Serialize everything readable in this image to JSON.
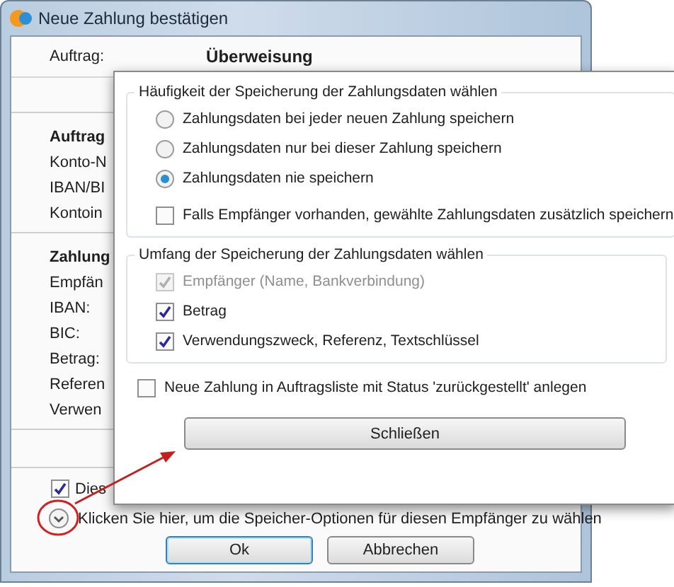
{
  "window": {
    "title": "Neue Zahlung bestätigen"
  },
  "order": {
    "label": "Auftrag:",
    "value": "Überweisung"
  },
  "sections": [
    {
      "title": "Auftrag",
      "fields": [
        "Konto-N",
        "IBAN/BI",
        "Kontoin"
      ]
    },
    {
      "title": "Zahlung",
      "fields": [
        "Empfän",
        "IBAN:",
        "BIC:",
        "Betrag:",
        "Referen",
        "Verwen"
      ]
    }
  ],
  "save_checkbox": {
    "label": "Dies",
    "checked": true
  },
  "options_link": "Klicken Sie hier, um die Speicher-Optionen für diesen Empfänger zu wählen",
  "buttons": [
    {
      "label": "Ok",
      "default": true
    },
    {
      "label": "Abbrechen",
      "default": false
    }
  ],
  "popup": {
    "frequency": {
      "title": "Häufigkeit der Speicherung der Zahlungsdaten wählen",
      "options": [
        {
          "label": "Zahlungsdaten bei jeder neuen Zahlung speichern",
          "selected": false
        },
        {
          "label": "Zahlungsdaten nur bei dieser Zahlung speichern",
          "selected": false
        },
        {
          "label": "Zahlungsdaten nie speichern",
          "selected": true
        }
      ],
      "extra": {
        "label": "Falls Empfänger vorhanden, gewählte Zahlungsdaten zusätzlich speichern",
        "checked": false
      }
    },
    "scope": {
      "title": "Umfang der Speicherung der Zahlungsdaten wählen",
      "items": [
        {
          "label": "Empfänger (Name, Bankverbindung)",
          "checked": true,
          "disabled": true
        },
        {
          "label": "Betrag",
          "checked": true,
          "disabled": false
        },
        {
          "label": "Verwendungszweck, Referenz, Textschlüssel",
          "checked": true,
          "disabled": false
        }
      ]
    },
    "defer": {
      "label": "Neue Zahlung in Auftragsliste mit Status 'zurückgestellt' anlegen",
      "checked": false
    },
    "close_button": "Schließen"
  }
}
